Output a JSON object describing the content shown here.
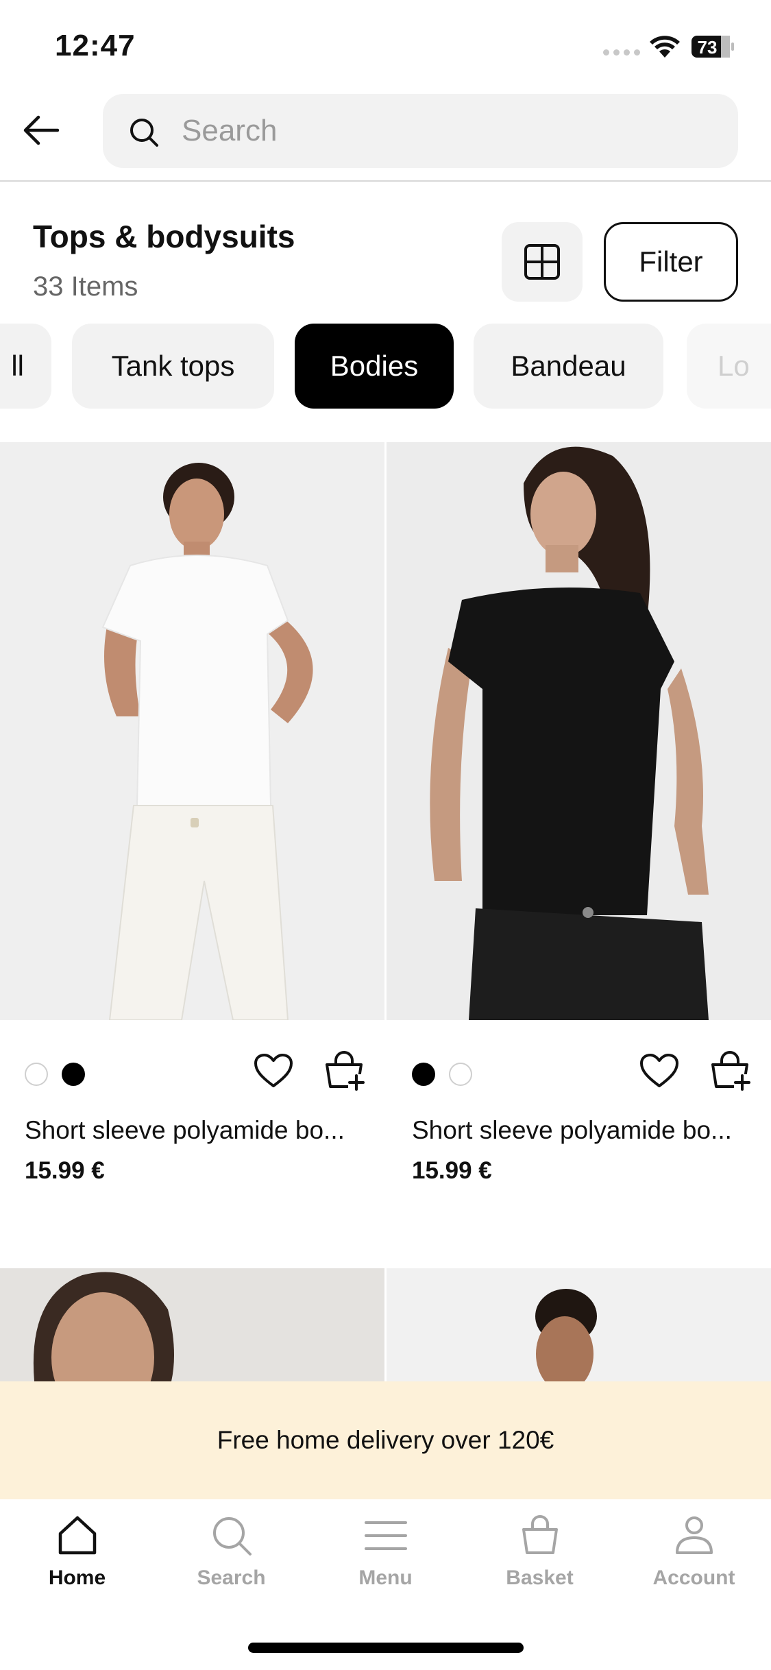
{
  "status": {
    "time": "12:47",
    "battery": "73"
  },
  "search": {
    "placeholder": "Search"
  },
  "category": {
    "title": "Tops & bodysuits",
    "count": "33 Items",
    "filter_label": "Filter"
  },
  "chips": [
    "ll",
    "Tank tops",
    "Bodies",
    "Bandeau",
    "Lo"
  ],
  "active_chip": "Bodies",
  "products": [
    {
      "name": "Short sleeve polyamide bo...",
      "price": "15.99 €",
      "swatches": [
        "white",
        "black"
      ]
    },
    {
      "name": "Short sleeve polyamide bo...",
      "price": "15.99 €",
      "swatches": [
        "black",
        "white"
      ]
    }
  ],
  "promo": "Free home delivery over 120€",
  "tabs": [
    {
      "label": "Home",
      "icon": "home-icon",
      "active": true
    },
    {
      "label": "Search",
      "icon": "search-icon",
      "active": false
    },
    {
      "label": "Menu",
      "icon": "menu-icon",
      "active": false
    },
    {
      "label": "Basket",
      "icon": "basket-icon",
      "active": false
    },
    {
      "label": "Account",
      "icon": "account-icon",
      "active": false
    }
  ],
  "colors": {
    "accent": "#000000",
    "promo_bg": "#fdf1d9",
    "chip_bg": "#f2f2f2",
    "inactive_tab": "#a5a5a5"
  }
}
